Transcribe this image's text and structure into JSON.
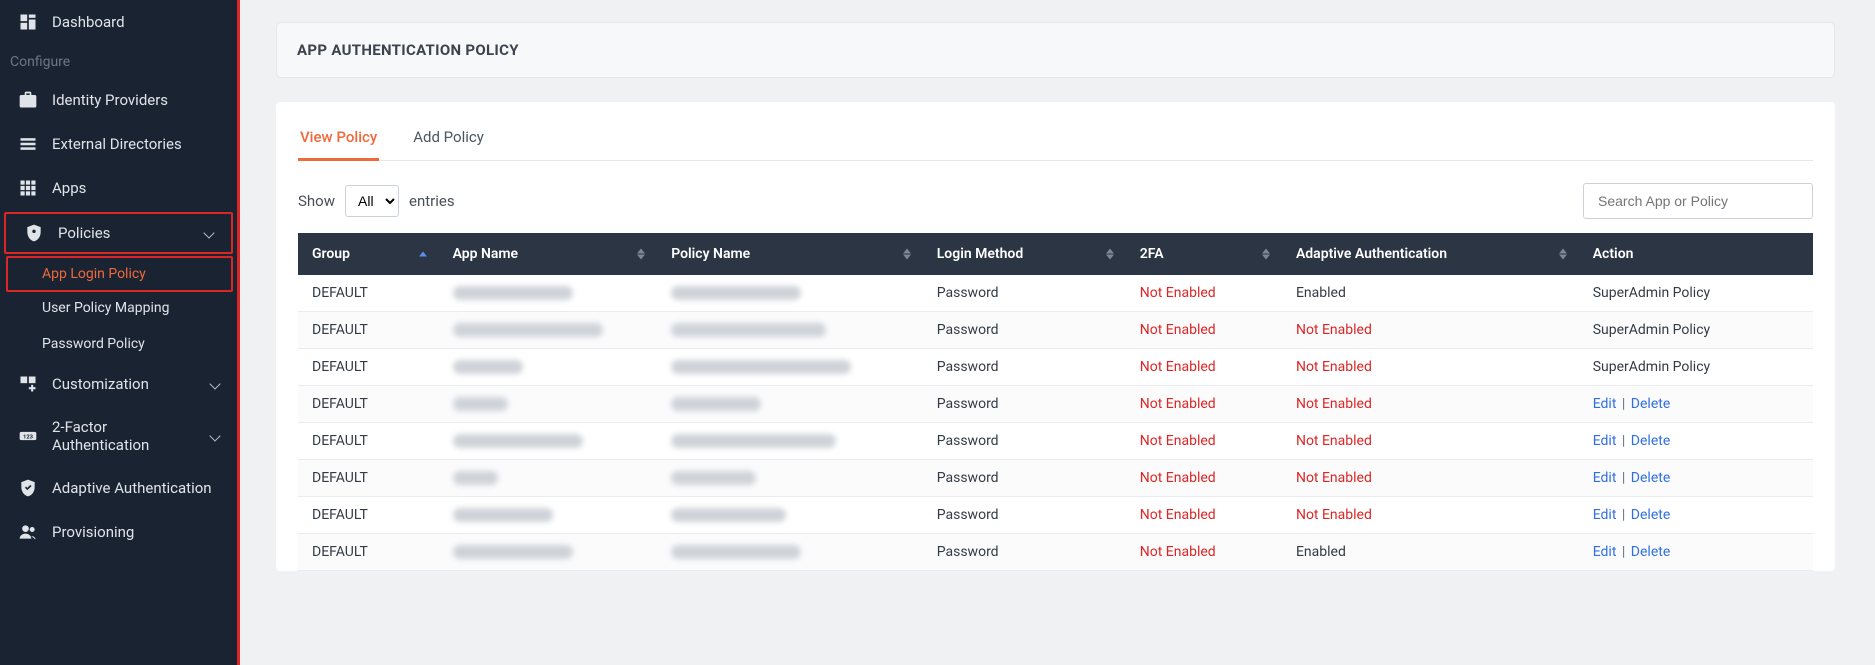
{
  "sidebar": {
    "dashboard": "Dashboard",
    "section_configure": "Configure",
    "identity_providers": "Identity Providers",
    "external_directories": "External Directories",
    "apps": "Apps",
    "policies": "Policies",
    "policies_sub": {
      "app_login": "App Login Policy",
      "user_policy_mapping": "User Policy Mapping",
      "password_policy": "Password Policy"
    },
    "customization": "Customization",
    "two_factor": "2-Factor Authentication",
    "adaptive_auth": "Adaptive Authentication",
    "provisioning": "Provisioning"
  },
  "page": {
    "title": "APP AUTHENTICATION POLICY",
    "tabs": {
      "view": "View Policy",
      "add": "Add Policy"
    },
    "show_label": "Show",
    "entries_label": "entries",
    "show_value": "All",
    "search_placeholder": "Search App or Policy"
  },
  "table": {
    "columns": {
      "group": "Group",
      "app_name": "App Name",
      "policy_name": "Policy Name",
      "login_method": "Login Method",
      "two_fa": "2FA",
      "adaptive": "Adaptive Authentication",
      "action": "Action"
    },
    "rows": [
      {
        "group": "DEFAULT",
        "app_name": "",
        "app_w": 120,
        "policy_name": "",
        "pol_w": 130,
        "login_method": "Password",
        "two_fa": "Not Enabled",
        "two_fa_red": true,
        "adaptive": "Enabled",
        "adaptive_red": false,
        "action_type": "text",
        "action_text": "SuperAdmin Policy"
      },
      {
        "group": "DEFAULT",
        "app_name": "",
        "app_w": 150,
        "policy_name": "",
        "pol_w": 155,
        "login_method": "Password",
        "two_fa": "Not Enabled",
        "two_fa_red": true,
        "adaptive": "Not Enabled",
        "adaptive_red": true,
        "action_type": "text",
        "action_text": "SuperAdmin Policy"
      },
      {
        "group": "DEFAULT",
        "app_name": "",
        "app_w": 70,
        "policy_name": "",
        "pol_w": 180,
        "login_method": "Password",
        "two_fa": "Not Enabled",
        "two_fa_red": true,
        "adaptive": "Not Enabled",
        "adaptive_red": true,
        "action_type": "text",
        "action_text": "SuperAdmin Policy"
      },
      {
        "group": "DEFAULT",
        "app_name": "",
        "app_w": 55,
        "policy_name": "",
        "pol_w": 90,
        "login_method": "Password",
        "two_fa": "Not Enabled",
        "two_fa_red": true,
        "adaptive": "Not Enabled",
        "adaptive_red": true,
        "action_type": "links",
        "edit": "Edit",
        "delete": "Delete"
      },
      {
        "group": "DEFAULT",
        "app_name": "",
        "app_w": 130,
        "policy_name": "",
        "pol_w": 165,
        "login_method": "Password",
        "two_fa": "Not Enabled",
        "two_fa_red": true,
        "adaptive": "Not Enabled",
        "adaptive_red": true,
        "action_type": "links",
        "edit": "Edit",
        "delete": "Delete"
      },
      {
        "group": "DEFAULT",
        "app_name": "",
        "app_w": 45,
        "policy_name": "",
        "pol_w": 85,
        "login_method": "Password",
        "two_fa": "Not Enabled",
        "two_fa_red": true,
        "adaptive": "Not Enabled",
        "adaptive_red": true,
        "action_type": "links",
        "edit": "Edit",
        "delete": "Delete"
      },
      {
        "group": "DEFAULT",
        "app_name": "",
        "app_w": 100,
        "policy_name": "",
        "pol_w": 115,
        "login_method": "Password",
        "two_fa": "Not Enabled",
        "two_fa_red": true,
        "adaptive": "Not Enabled",
        "adaptive_red": true,
        "action_type": "links",
        "edit": "Edit",
        "delete": "Delete"
      },
      {
        "group": "DEFAULT",
        "app_name": "",
        "app_w": 120,
        "policy_name": "",
        "pol_w": 130,
        "login_method": "Password",
        "two_fa": "Not Enabled",
        "two_fa_red": true,
        "adaptive": "Enabled",
        "adaptive_red": false,
        "action_type": "links",
        "edit": "Edit",
        "delete": "Delete"
      }
    ]
  }
}
